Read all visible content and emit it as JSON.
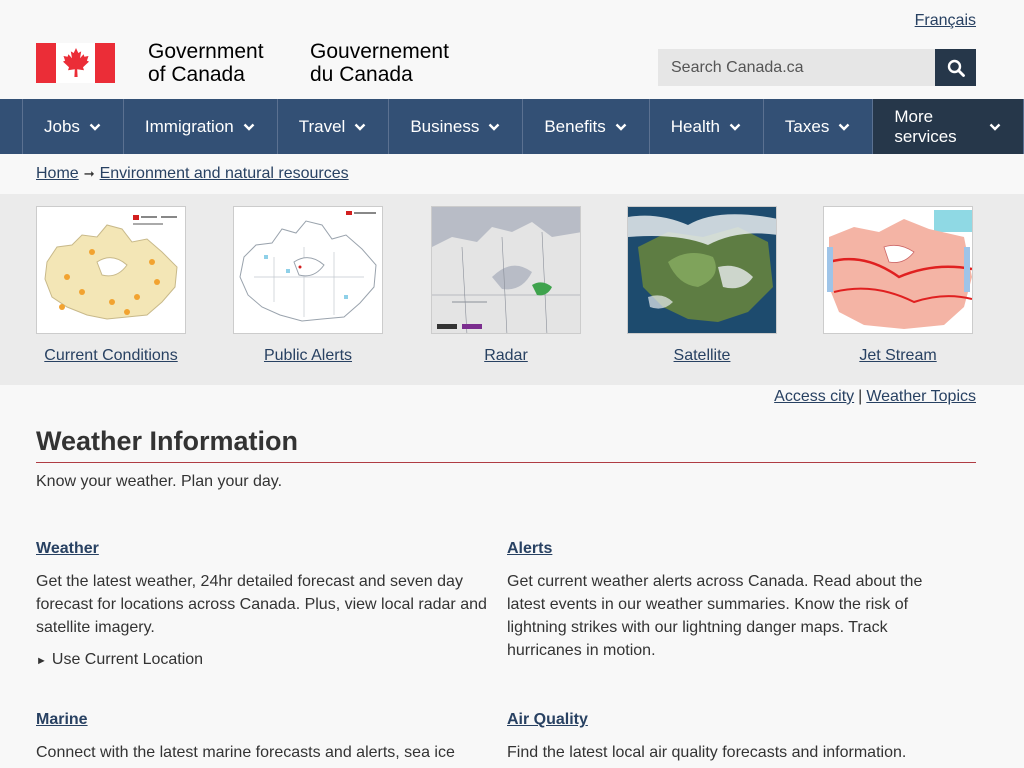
{
  "header": {
    "language_link": "Français",
    "signature_en_line1": "Government",
    "signature_en_line2": "of Canada",
    "signature_fr_line1": "Gouvernement",
    "signature_fr_line2": "du Canada",
    "search_placeholder": "Search Canada.ca",
    "search_icon": "search-icon",
    "flag_icon": "canada-flag-icon"
  },
  "nav": {
    "items": [
      {
        "label": "Jobs"
      },
      {
        "label": "Immigration"
      },
      {
        "label": "Travel"
      },
      {
        "label": "Business"
      },
      {
        "label": "Benefits"
      },
      {
        "label": "Health"
      },
      {
        "label": "Taxes"
      },
      {
        "label": "More services"
      }
    ]
  },
  "breadcrumb": {
    "home": "Home",
    "section": "Environment and natural resources"
  },
  "tiles": [
    {
      "label": "Current Conditions"
    },
    {
      "label": "Public Alerts"
    },
    {
      "label": "Radar"
    },
    {
      "label": "Satellite"
    },
    {
      "label": "Jet Stream"
    }
  ],
  "quick_links": {
    "access_city": "Access city",
    "separator": "|",
    "weather_topics": "Weather Topics"
  },
  "page": {
    "title": "Weather Information",
    "lead": "Know your weather. Plan your day."
  },
  "sections": {
    "weather": {
      "title": "Weather",
      "text": "Get the latest weather, 24hr detailed forecast and seven day forecast for locations across Canada. Plus, view local radar and satellite imagery.",
      "location_link": "Use Current Location"
    },
    "alerts": {
      "title": "Alerts",
      "text": "Get current weather alerts across Canada. Read about the latest events in our weather summaries. Know the risk of lightning strikes with our lightning danger maps. Track hurricanes in motion."
    },
    "marine": {
      "title": "Marine",
      "text": "Connect with the latest marine forecasts and alerts, sea ice"
    },
    "air_quality": {
      "title": "Air Quality",
      "text": "Find the latest local air quality forecasts and information."
    }
  },
  "colors": {
    "nav_bg": "#335075",
    "nav_more_bg": "#26374a",
    "link": "#284162",
    "flag_red": "#eb2d37",
    "title_rule": "#af3c43"
  }
}
